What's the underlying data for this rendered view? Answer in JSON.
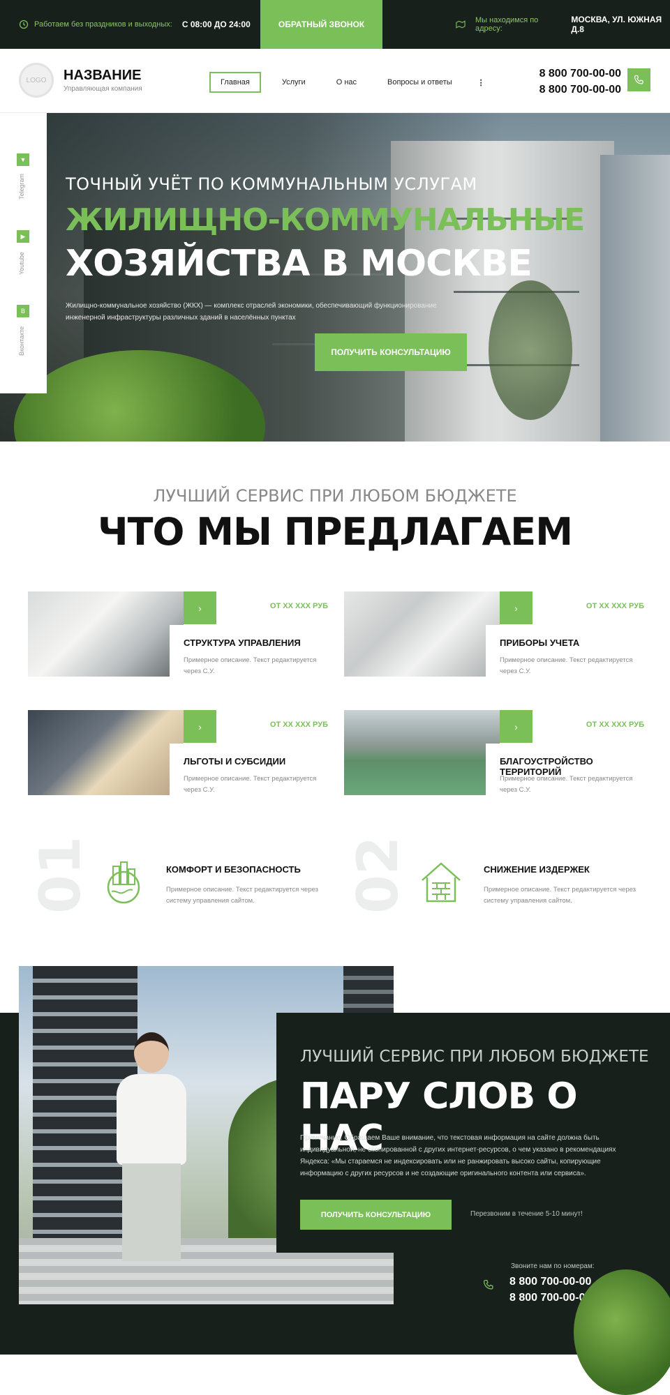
{
  "topbar": {
    "hours_label": "Работаем без праздников и выходных:",
    "hours_value": "С 08:00 ДО 24:00",
    "callback_button": "ОБРАТНЫЙ ЗВОНОК",
    "address_label": "Мы находимся по адресу:",
    "address_value": "МОСКВА, УЛ. ЮЖНАЯ Д.8"
  },
  "header": {
    "logo_text": "LOGO",
    "brand_name": "НАЗВАНИЕ",
    "brand_sub": "Управляющая компания",
    "nav": [
      "Главная",
      "Услуги",
      "О нас",
      "Вопросы и ответы"
    ],
    "more_icon": "⋮",
    "phones": [
      "8 800 700-00-00",
      "8 800 700-00-00"
    ]
  },
  "social": [
    "Telegram",
    "Youtube",
    "Вконтакте"
  ],
  "hero": {
    "kicker": "ТОЧНЫЙ УЧЁТ ПО КОММУНАЛЬНЫМ УСЛУГАМ",
    "title_line1": "ЖИЛИЩНО-КОММУНАЛЬНЫЕ",
    "title_line2": "ХОЗЯЙСТВА В МОСКВЕ",
    "description": "Жилищно-коммунальное хозяйство (ЖКХ) — комплекс отраслей экономики, обеспечивающий функционирование инженерной инфраструктуры различных зданий в населённых пунктах",
    "button": "ПОЛУЧИТЬ КОНСУЛЬТАЦИЮ"
  },
  "offers": {
    "kicker": "ЛУЧШИЙ СЕРВИС ПРИ ЛЮБОМ БЮДЖЕТЕ",
    "title": "ЧТО МЫ ПРЕДЛАГАЕМ",
    "cards": [
      {
        "title": "СТРУКТУРА УПРАВЛЕНИЯ",
        "price": "ОТ ХХ ХХХ РУБ",
        "desc": "Примерное описание. Текст редактируется через С.У.",
        "arrow": "›"
      },
      {
        "title": "ПРИБОРЫ УЧЕТА",
        "price": "ОТ ХХ ХХХ РУБ",
        "desc": "Примерное описание. Текст редактируется через С.У.",
        "arrow": "›"
      },
      {
        "title": "ЛЬГОТЫ И СУБСИДИИ",
        "price": "ОТ ХХ ХХХ РУБ",
        "desc": "Примерное описание. Текст редактируется через С.У.",
        "arrow": "›"
      },
      {
        "title": "БЛАГОУСТРОЙСТВО ТЕРРИТОРИЙ",
        "price": "ОТ ХХ ХХХ РУБ",
        "desc": "Примерное описание. Текст редактируется через С.У.",
        "arrow": "›"
      }
    ]
  },
  "features": [
    {
      "num": "01",
      "title": "КОМФОРТ И БЕЗОПАСНОСТЬ",
      "desc": "Примерное описание. Текст редактируется через систему управления сайтом.",
      "icon": "city-globe-icon"
    },
    {
      "num": "02",
      "title": "СНИЖЕНИЕ ИЗДЕРЖЕК",
      "desc": "Примерное описание. Текст редактируется через систему управления сайтом.",
      "icon": "house-brick-icon"
    }
  ],
  "about": {
    "kicker": "ЛУЧШИЙ СЕРВИС ПРИ ЛЮБОМ БЮДЖЕТЕ",
    "title": "ПАРУ СЛОВ О НАС",
    "text": "Примечание. Обращаем Ваше внимание, что текстовая информация на сайте должна быть индивидуальной, не скопированной с других интернет-ресурсов, о чем указано в рекомендациях Яндекса: «Мы стараемся не индексировать или не ранжировать высоко сайты, копирующие информацию с других ресурсов и не создающие оригинального контента или сервиса».",
    "button": "ПОЛУЧИТЬ КОНСУЛЬТАЦИЮ",
    "note": "Перезвоним в течение 5-10 минут!",
    "call_label": "Звоните нам по номерам:",
    "phones": [
      "8 800 700-00-00",
      "8 800 700-00-00"
    ]
  },
  "colors": {
    "accent": "#7bbf58",
    "dark": "#17201b"
  }
}
